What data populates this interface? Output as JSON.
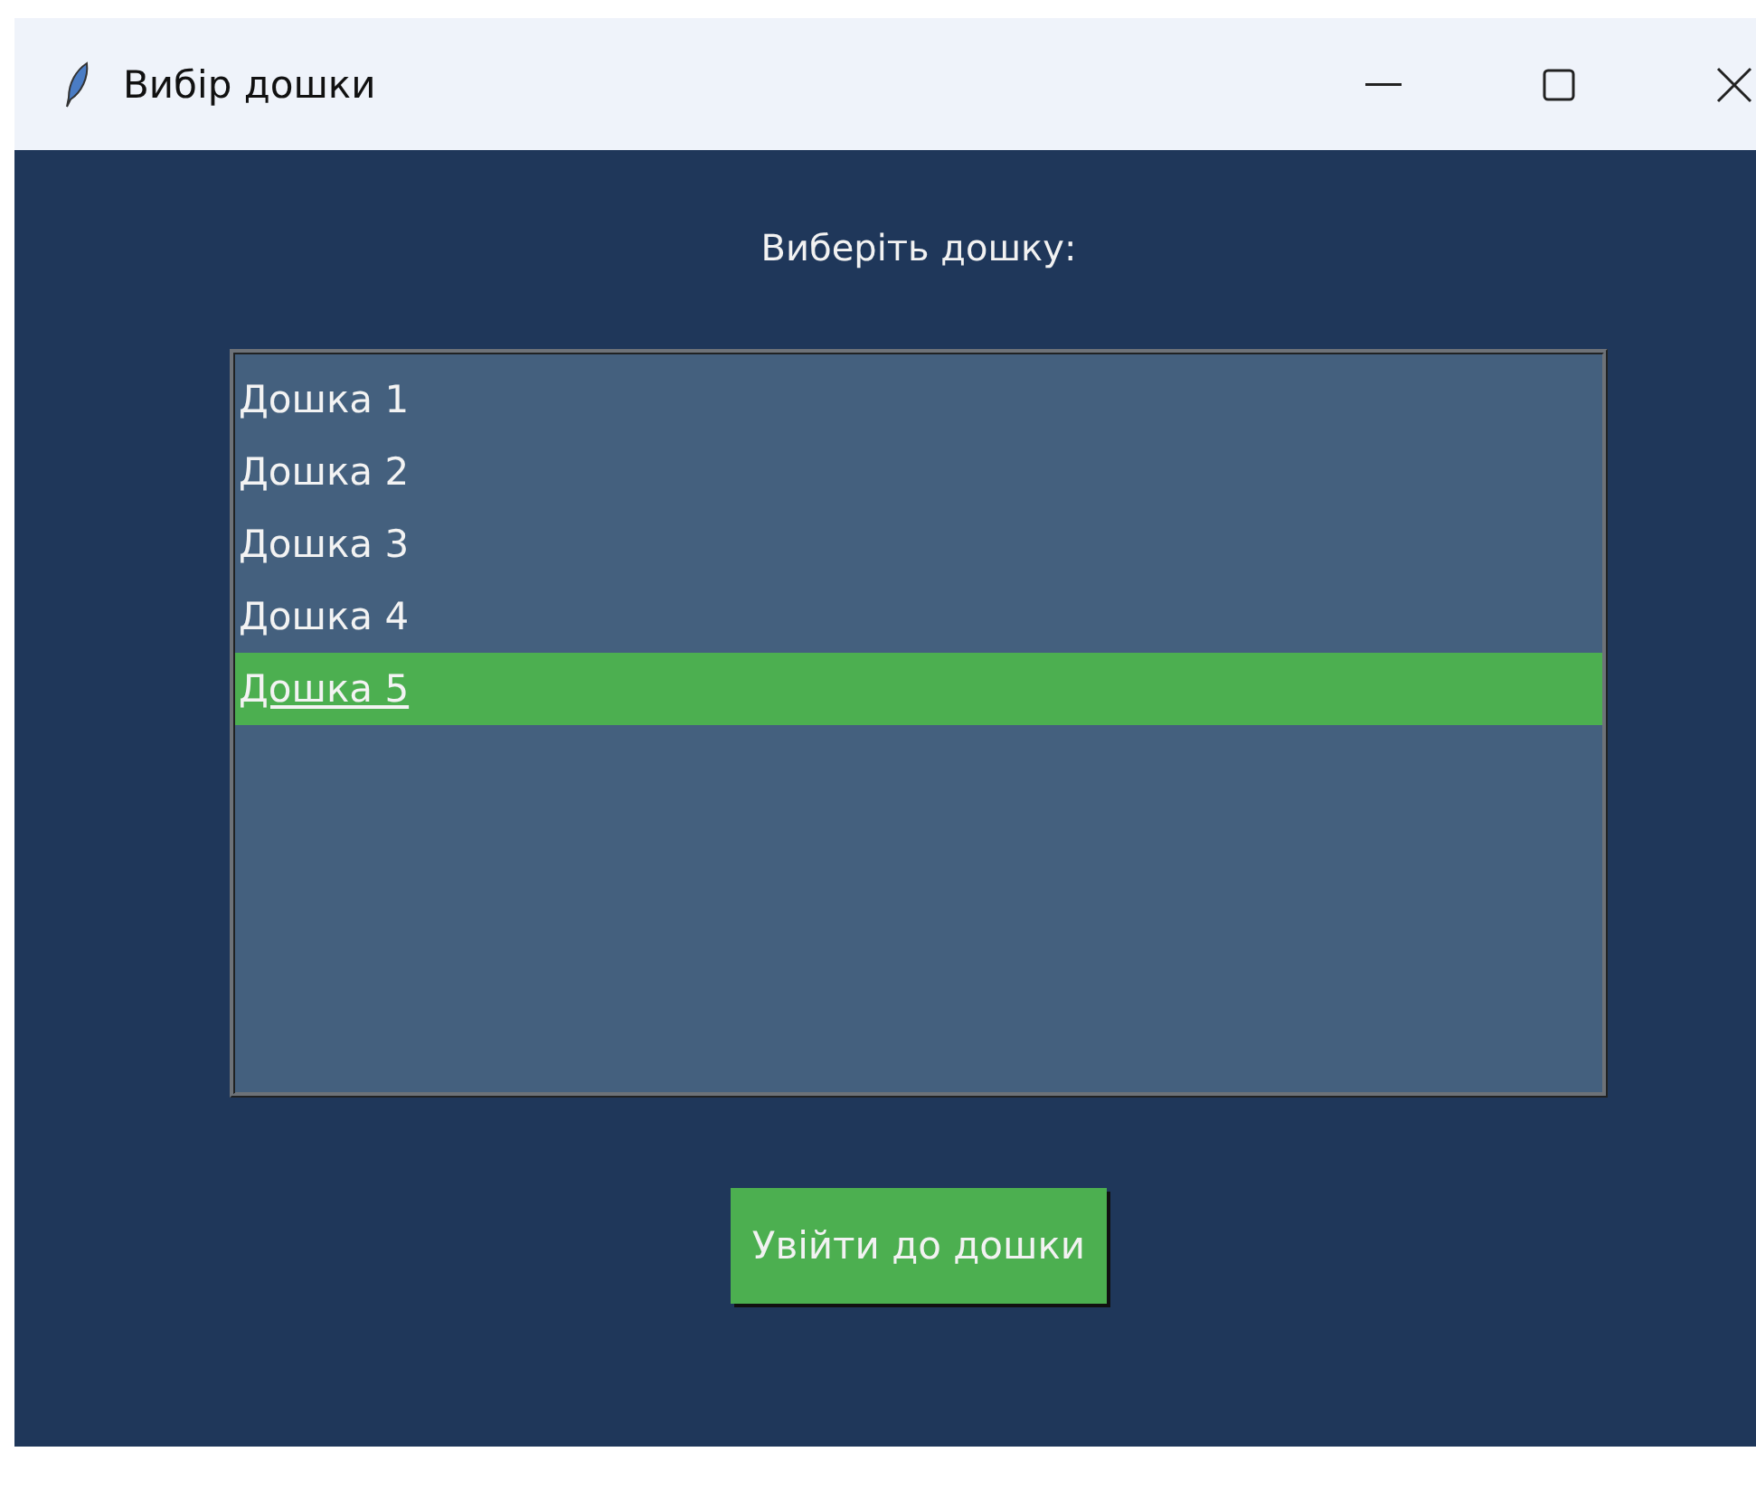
{
  "window": {
    "title": "Вибір дошки"
  },
  "prompt": "Виберіть дошку:",
  "boards": [
    {
      "label": "Дошка 1",
      "selected": false
    },
    {
      "label": "Дошка 2",
      "selected": false
    },
    {
      "label": "Дошка 3",
      "selected": false
    },
    {
      "label": "Дошка 4",
      "selected": false
    },
    {
      "label": "Дошка 5",
      "selected": true
    }
  ],
  "button": "Увійти до дошки"
}
